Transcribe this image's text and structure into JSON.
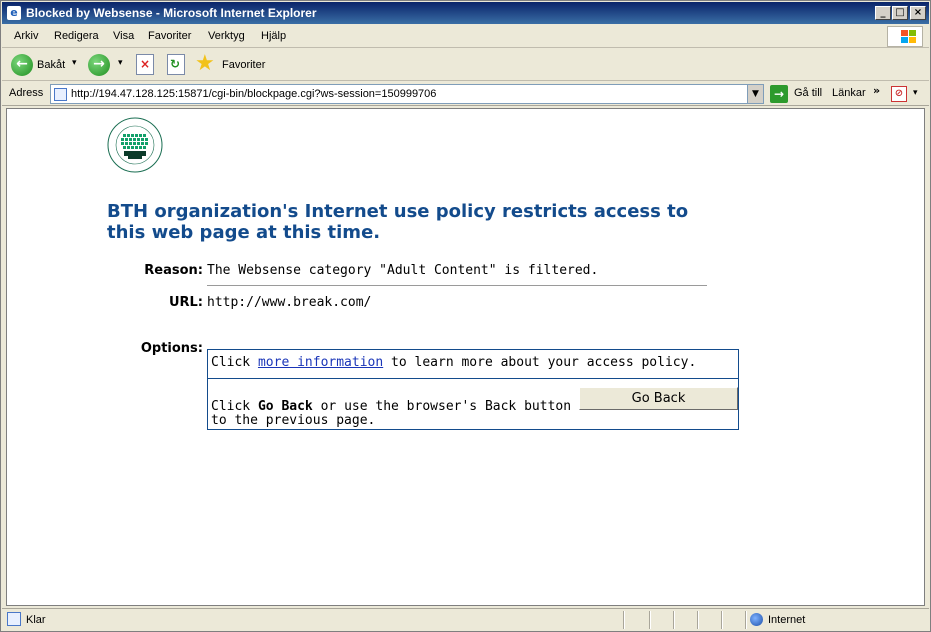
{
  "window": {
    "title": "Blocked by Websense - Microsoft Internet Explorer"
  },
  "menu": [
    "Arkiv",
    "Redigera",
    "Visa",
    "Favoriter",
    "Verktyg",
    "Hjälp"
  ],
  "toolbar": {
    "back_label": "Bakåt",
    "favorites_label": "Favoriter"
  },
  "address": {
    "label": "Adress",
    "url": "http://194.47.128.125:15871/cgi-bin/blockpage.cgi?ws-session=150999706",
    "go_label": "Gå till",
    "links_label": "Länkar"
  },
  "page": {
    "headline": "BTH organization's Internet use policy restricts access to this web page at this time.",
    "reason_label": "Reason:",
    "reason_value": "The Websense category \"Adult Content\" is filtered.",
    "url_label": "URL:",
    "url_value": "http://www.break.com/",
    "options_label": "Options:",
    "option1_prefix": "Click ",
    "option1_link": "more information",
    "option1_suffix": " to learn more about your access policy.",
    "option2_prefix": "Click ",
    "option2_bold": "Go Back",
    "option2_suffix": " or use the browser's Back button to return",
    "option2_line2": "to the previous page.",
    "go_back_button": "Go Back"
  },
  "status": {
    "text": "Klar",
    "zone": "Internet"
  },
  "colors": {
    "headline": "#134b8c",
    "link": "#1a35b8",
    "logo": "#12a06a"
  }
}
